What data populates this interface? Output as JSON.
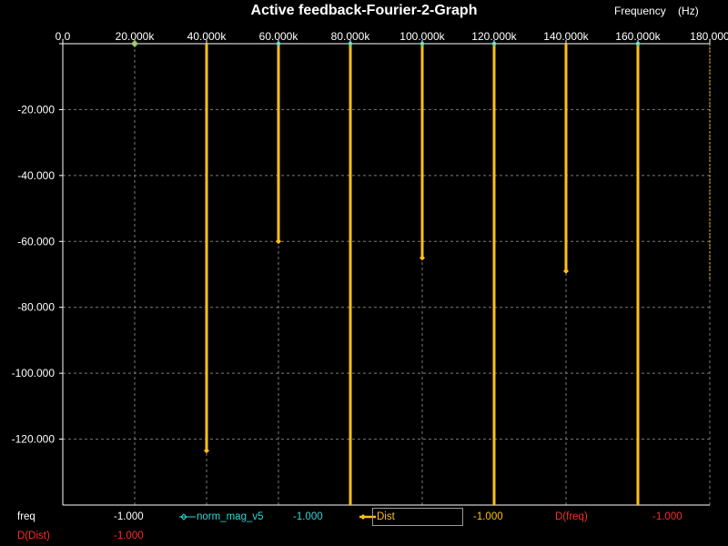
{
  "colors": {
    "background": "#000000",
    "plot_border": "#ffffff",
    "grid": "#7a7a7a",
    "text": "#ffffff",
    "dist_series": "#ffbf1a",
    "norm_mag_series": "#33d6d6",
    "cursor_red": "#ff2a2a"
  },
  "cursor_readout": {
    "freq_label": "freq",
    "freq_value_1": "-1.000",
    "norm_mag_label": "norm_mag_v5",
    "norm_mag_value": "-1.000",
    "dist_label": "Dist",
    "dist_value": "-1.000",
    "dfreq_label": "D(freq)",
    "dfreq_value": "-1.000",
    "ddist_label": "D(Dist)",
    "ddist_value": "-1.000"
  },
  "chart_data": {
    "type": "line",
    "title": "Active feedback-Fourier-2-Graph",
    "xlabel": "Frequency    (Hz)",
    "ylabel": "",
    "xlim": [
      0,
      180000
    ],
    "ylim": [
      -140,
      0
    ],
    "x_ticks": [
      0,
      20000,
      40000,
      60000,
      80000,
      100000,
      120000,
      140000,
      160000,
      180000
    ],
    "x_tick_labels": [
      "0.0",
      "20.000k",
      "40.000k",
      "60.000k",
      "80.000k",
      "100.000k",
      "120.000k",
      "140.000k",
      "160.000k",
      "180.000"
    ],
    "y_ticks": [
      0,
      -20,
      -40,
      -60,
      -80,
      -100,
      -120
    ],
    "y_tick_labels": [
      "",
      "-20.000",
      "-40.000",
      "-60.000",
      "-80.000",
      "-100.000",
      "-120.000"
    ],
    "grid": true,
    "series": [
      {
        "name": "Dist",
        "color": "#ffbf1a",
        "points": [
          {
            "x": 20000,
            "y": 0,
            "top": 0
          },
          {
            "x": 40000,
            "y": -123.5,
            "top": 0
          },
          {
            "x": 60000,
            "y": -60,
            "top": 0
          },
          {
            "x": 80000,
            "y": -140,
            "top": 0
          },
          {
            "x": 100000,
            "y": -65,
            "top": 0
          },
          {
            "x": 120000,
            "y": -140,
            "top": 0
          },
          {
            "x": 140000,
            "y": -69,
            "top": 0
          },
          {
            "x": 160000,
            "y": -140,
            "top": 0
          },
          {
            "x": 180000,
            "y": -71.5,
            "top": 0
          }
        ]
      },
      {
        "name": "norm_mag_v5",
        "color": "#33d6d6",
        "points": [
          {
            "x": 20000,
            "y": 0
          },
          {
            "x": 60000,
            "y": 0
          },
          {
            "x": 80000,
            "y": 0
          },
          {
            "x": 100000,
            "y": 0
          },
          {
            "x": 120000,
            "y": 0
          },
          {
            "x": 160000,
            "y": 0
          }
        ]
      }
    ]
  }
}
